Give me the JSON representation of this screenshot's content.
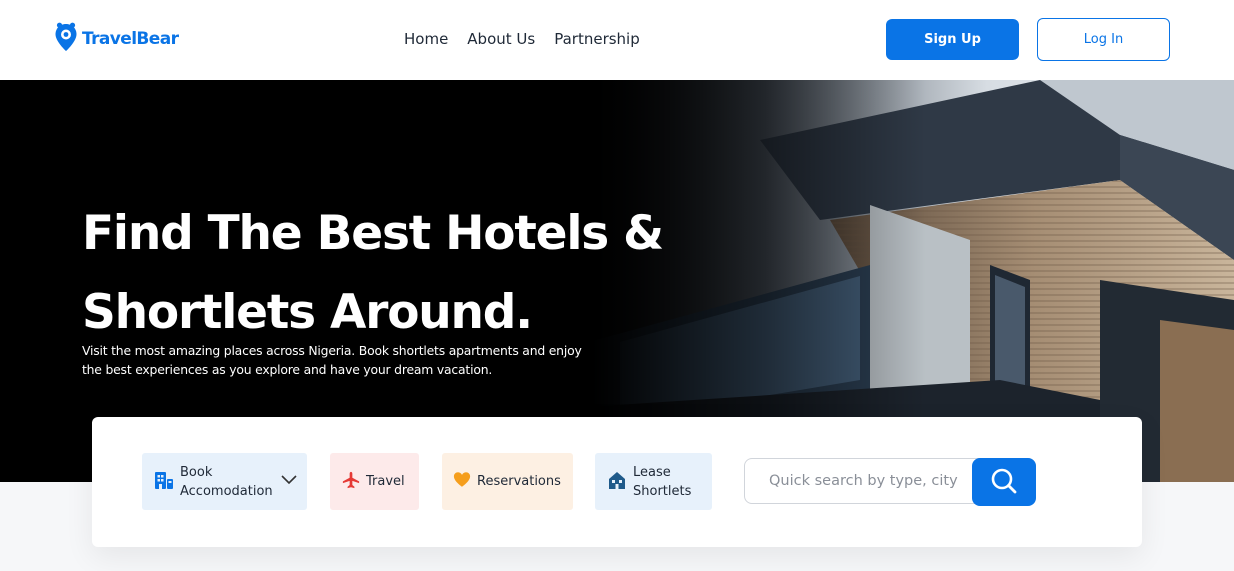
{
  "header": {
    "logo_text": "TravelBear",
    "nav": [
      "Home",
      "About Us",
      "Partnership"
    ],
    "signup_label": "Sign Up",
    "login_label": "Log In"
  },
  "hero": {
    "title_line1": "Find The Best Hotels &",
    "title_line2": "Shortlets Around.",
    "subtitle_line1": "Visit the most amazing places across Nigeria. Book shortlets apartments and enjoy",
    "subtitle_line2": "the best experiences as you explore and have your dream vacation."
  },
  "search_card": {
    "chips": [
      {
        "label_line1": "Book",
        "label_line2": "Accomodation",
        "icon": "building-icon",
        "has_dropdown": true
      },
      {
        "label": "Travel",
        "icon": "airplane-icon"
      },
      {
        "label": "Reservations",
        "icon": "heart-icon"
      },
      {
        "label_line1": "Lease",
        "label_line2": "Shortlets",
        "icon": "house-icon"
      }
    ],
    "search_placeholder": "Quick search by type, city",
    "search_icon": "search-icon"
  },
  "colors": {
    "brand": "#0a74e6",
    "chip_blue": "#e7f1fb",
    "chip_red": "#fdeaea",
    "chip_orange": "#fdf0e3",
    "airplane": "#e53935",
    "heart": "#f59e1c"
  }
}
